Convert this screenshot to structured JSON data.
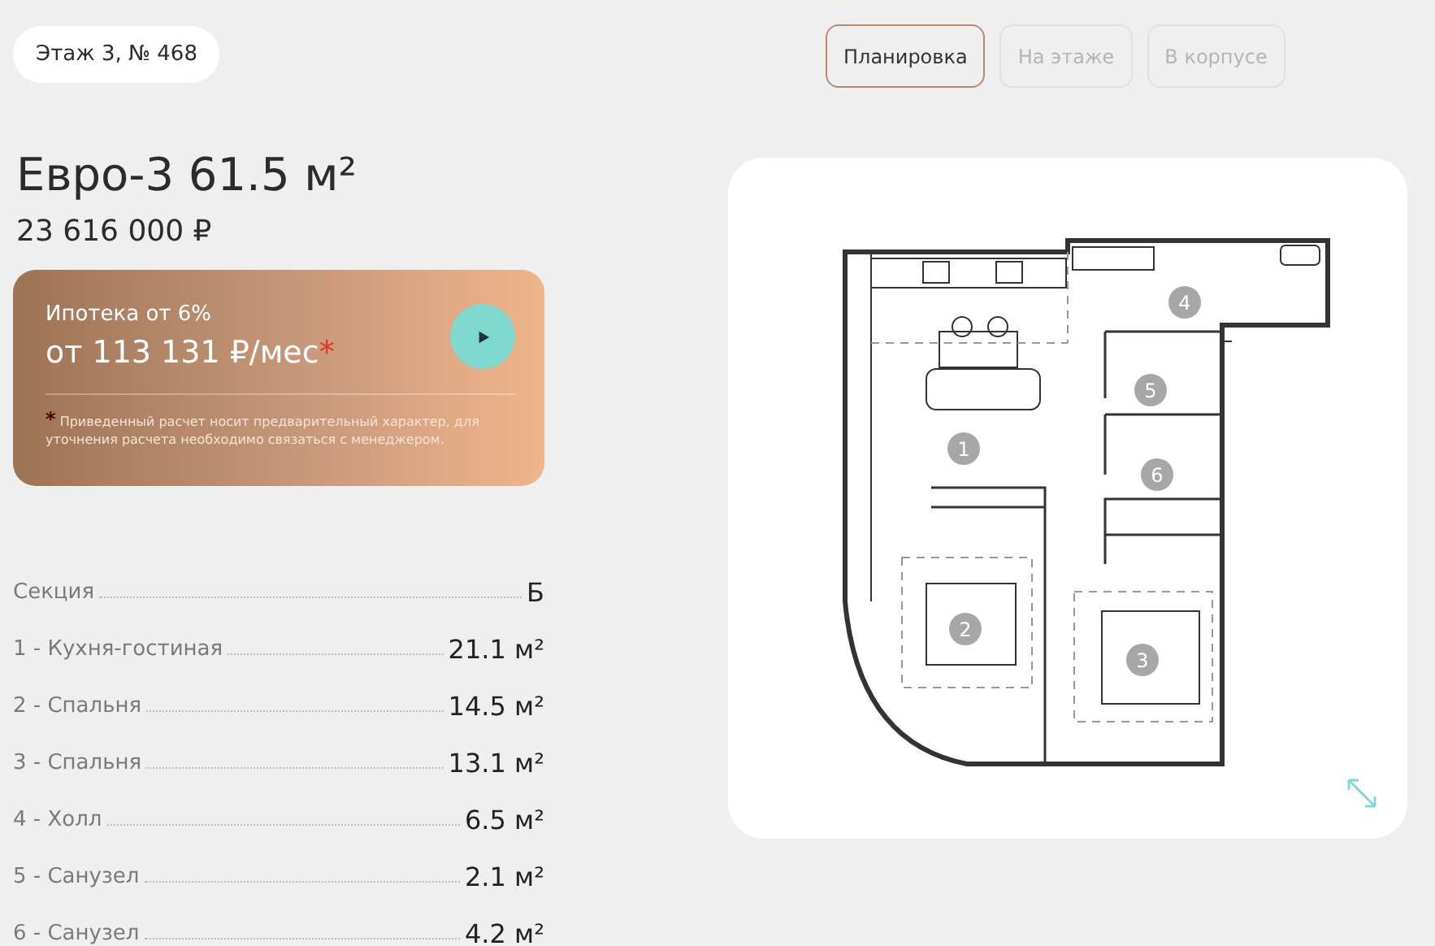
{
  "badge": "Этаж 3, № 468",
  "tabs": [
    {
      "label": "Планировка",
      "selected": true
    },
    {
      "label": "На этаже",
      "selected": false
    },
    {
      "label": "В корпусе",
      "selected": false
    }
  ],
  "title": "Евро-3 61.5 м²",
  "price": "23 616 000 ₽",
  "mortgage": {
    "label": "Ипотека от 6%",
    "payment": "от 113 131 ₽/мес",
    "mark": "*",
    "note_mark": "*",
    "note": "Приведенный расчет носит предварительный характер, для уточнения расчета необходимо связаться с менеджером."
  },
  "specs": [
    {
      "label": "Секция",
      "value": "Б"
    },
    {
      "label": "1 - Кухня-гостиная",
      "value": "21.1 м²"
    },
    {
      "label": "2 - Спальня",
      "value": "14.5 м²"
    },
    {
      "label": "3 - Спальня",
      "value": "13.1 м²"
    },
    {
      "label": "4 - Холл",
      "value": "6.5 м²"
    },
    {
      "label": "5 - Санузел",
      "value": "2.1 м²"
    },
    {
      "label": "6 - Санузел",
      "value": "4.2 м²"
    }
  ],
  "plan": {
    "rooms": [
      "1",
      "2",
      "3",
      "4",
      "5",
      "6"
    ]
  }
}
